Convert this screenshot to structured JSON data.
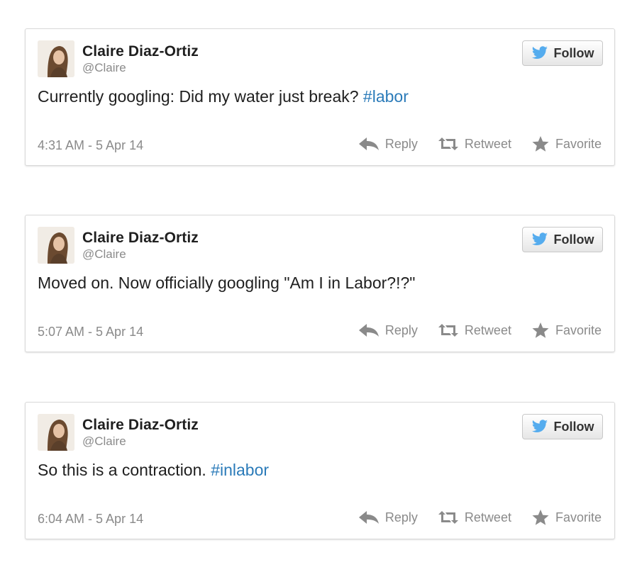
{
  "colors": {
    "hashtag": "#2b7bb9",
    "twitter_bird": "#55acee",
    "action_gray": "#8a8a8a",
    "text": "#1f1f1f"
  },
  "icons": {
    "bird": "twitter-bird-icon",
    "reply": "reply-arrow-icon",
    "retweet": "retweet-icon",
    "favorite": "star-icon"
  },
  "tweets": [
    {
      "name": "Claire Diaz-Ortiz",
      "handle": "@Claire",
      "follow_label": "Follow",
      "text": "Currently googling: Did my water just break? ",
      "hashtag": "#labor",
      "timestamp": "4:31 AM - 5 Apr 14",
      "reply_label": "Reply",
      "retweet_label": "Retweet",
      "favorite_label": "Favorite"
    },
    {
      "name": "Claire Diaz-Ortiz",
      "handle": "@Claire",
      "follow_label": "Follow",
      "text": "Moved on. Now officially googling \"Am I in Labor?!?\"",
      "hashtag": "",
      "timestamp": "5:07 AM - 5 Apr 14",
      "reply_label": "Reply",
      "retweet_label": "Retweet",
      "favorite_label": "Favorite"
    },
    {
      "name": "Claire Diaz-Ortiz",
      "handle": "@Claire",
      "follow_label": "Follow",
      "text": "So this is a contraction. ",
      "hashtag": "#inlabor",
      "timestamp": "6:04 AM - 5 Apr 14",
      "reply_label": "Reply",
      "retweet_label": "Retweet",
      "favorite_label": "Favorite"
    }
  ]
}
